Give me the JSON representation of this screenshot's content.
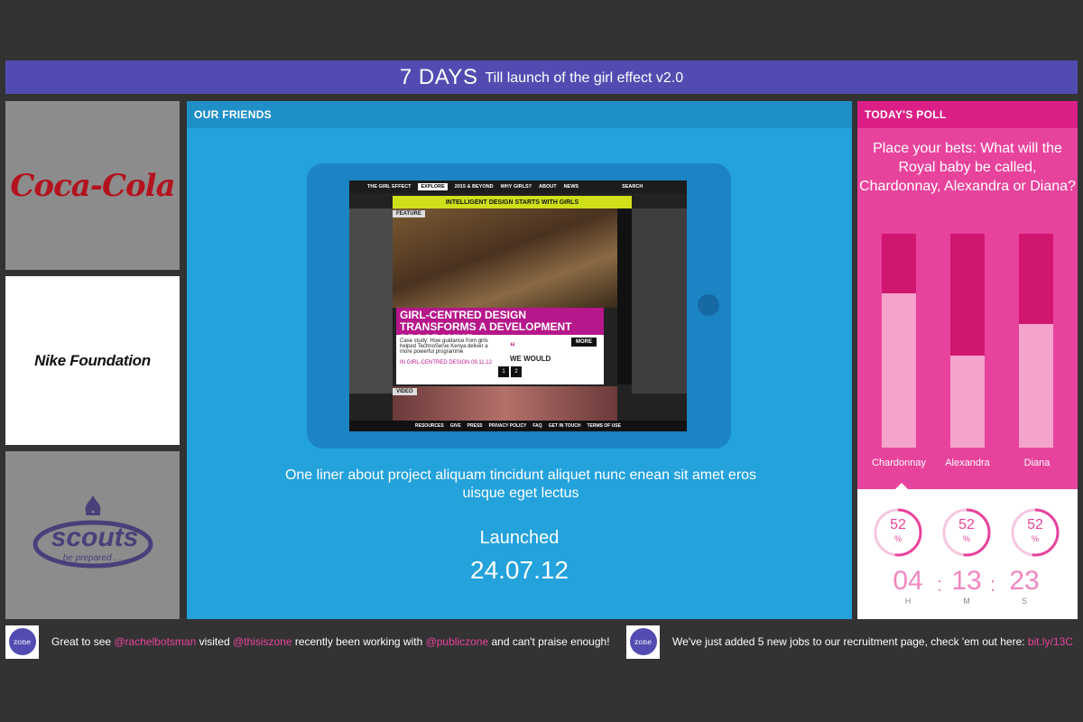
{
  "countdown_banner": {
    "days": "7 DAYS",
    "subtitle": "Till launch of the girl effect v2.0"
  },
  "partners": {
    "coca_cola": "Coca-Cola",
    "nike": "Nike Foundation",
    "scouts": "scouts",
    "scouts_motto": "be prepared . . ."
  },
  "friends_panel": {
    "header": "OUR FRIENDS",
    "screen": {
      "brand": "THE GIRL EFFECT",
      "nav": [
        "EXPLORE",
        "2015 & BEYOND",
        "WHY GIRLS?",
        "ABOUT",
        "NEWS"
      ],
      "search": "SEARCH",
      "banner": "INTELLIGENT DESIGN STARTS WITH GIRLS",
      "feature_label": "FEATURE",
      "headline": "GIRL-CENTRED DESIGN TRANSFORMS A DEVELOPMENT PROGRAMME",
      "case_study": "Case study: How guidance from girls helped TechnoServe Kenya deliver a more powerful programme",
      "category": "IN GIRL-CENTRED DESIGN 09.11.12",
      "more": "MORE",
      "quote_heading": "WE WOULD",
      "pages": [
        "1",
        "2"
      ],
      "video_label": "VIDEO",
      "footer_links": [
        "RESOURCES",
        "GIVE",
        "PRESS",
        "PRIVACY POLICY",
        "FAQ",
        "GET IN TOUCH",
        "TERMS OF USE"
      ]
    },
    "description": "One liner about project aliquam tincidunt aliquet nunc enean sit amet eros uisque eget lectus",
    "launched_label": "Launched",
    "launch_date": "24.07.12"
  },
  "poll": {
    "header": "TODAY'S POLL",
    "question": "Place your bets: What will the Royal baby be called, Chardonnay, Alexandra or Diana?",
    "options": [
      {
        "name": "Chardonnay",
        "share": 0.72
      },
      {
        "name": "Alexandra",
        "share": 0.43
      },
      {
        "name": "Diana",
        "share": 0.58
      }
    ],
    "results": [
      {
        "value": "52",
        "unit": "%",
        "fraction": 0.52
      },
      {
        "value": "52",
        "unit": "%",
        "fraction": 0.52
      },
      {
        "value": "52",
        "unit": "%",
        "fraction": 0.52
      }
    ],
    "timer": {
      "hours": "04",
      "minutes": "13",
      "seconds": "23",
      "h": "H",
      "m": "M",
      "s": "S",
      "sep": ":"
    },
    "colors": {
      "bar_dark": "#d0166f",
      "bar_light": "#f5a3cc",
      "accent": "#e8439c"
    }
  },
  "feed": {
    "avatar_label": "zone",
    "tweet1": {
      "p1": "Great to see ",
      "m1": "@rachelbotsman",
      "p2": " visited ",
      "m2": "@thisiszone",
      "p3": " recently been working with ",
      "m3": "@publiczone",
      "p4": " and can't praise enough!"
    },
    "tweet2": {
      "p1": "We've just added 5 new jobs to our recruitment page, check 'em out here: ",
      "link": "bit.ly/13C"
    }
  },
  "colors": {
    "banner": "#524cb2",
    "friends": "#23a2dc",
    "poll": "#e8439c",
    "background": "#333333"
  }
}
